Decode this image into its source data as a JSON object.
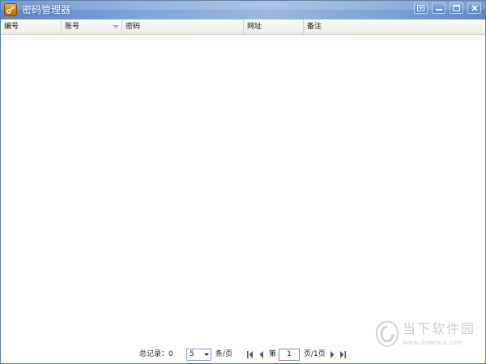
{
  "window": {
    "title": "密码管理器",
    "icon": "key-icon",
    "controls": [
      "menu-icon",
      "minimize-icon",
      "maximize-icon",
      "close-icon"
    ]
  },
  "table": {
    "columns": [
      {
        "label": "编号"
      },
      {
        "label": "账号",
        "sort_icon": "sort-down-icon"
      },
      {
        "label": "密码"
      },
      {
        "label": "网址"
      },
      {
        "label": "备注"
      }
    ],
    "rows": []
  },
  "pager": {
    "total_label": "总记录：",
    "total_value": "0",
    "per_page_value": "5",
    "per_page_unit": "条/页",
    "page_prefix": "第",
    "page_value": "1",
    "page_suffix": "页/1页"
  },
  "watermark": {
    "main_text": "当下软件园",
    "url": "www.downxia.com"
  },
  "colors": {
    "titlebar": "#6f98d2",
    "accent_value": "#1a4fd0",
    "header_border": "#d7d4c8"
  }
}
